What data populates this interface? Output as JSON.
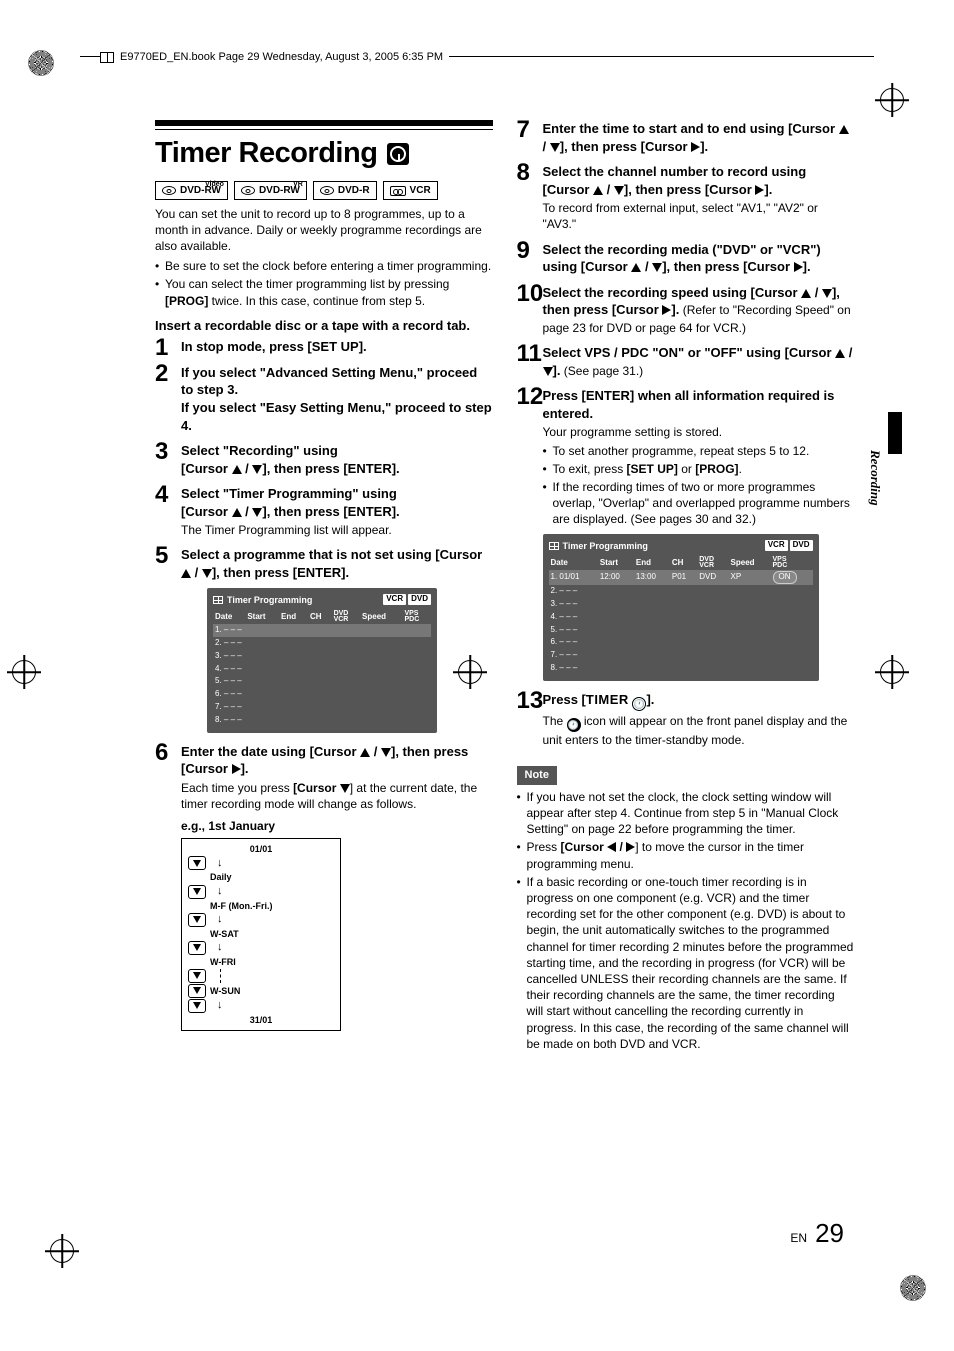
{
  "meta": {
    "header_text": "E9770ED_EN.book  Page 29  Wednesday, August 3, 2005  6:35 PM",
    "side_tab": "Recording",
    "footer_lang": "EN",
    "footer_page": "29"
  },
  "title": "Timer Recording",
  "formats": {
    "f1_label": "DVD-RW",
    "f1_sup": "Video",
    "f2_label": "DVD-RW",
    "f2_sup": "VR",
    "f3_label": "DVD-R",
    "f4_label": "VCR"
  },
  "intro": {
    "p1": "You can set the unit to record up to 8 programmes, up to a month in advance. Daily or weekly programme recordings are also available.",
    "b1": "Be sure to set the clock before entering a timer programming.",
    "b2_a": "You can select the timer programming list by pressing ",
    "b2_prog": "[PROG]",
    "b2_b": " twice. In this case, continue from step 5."
  },
  "lead": "Insert a recordable disc or a tape with a record tab.",
  "steps_left": {
    "s1": "In stop mode, press [SET UP].",
    "s2a": "If you select \"Advanced Setting Menu,\" proceed to step 3.",
    "s2b": "If you select \"Easy Setting Menu,\" proceed to step 4.",
    "s3a": "Select \"Recording\" using",
    "s3b": "[Cursor ",
    "s3c": "], then press [ENTER].",
    "s4a": "Select \"Timer Programming\" using",
    "s4b": "[Cursor ",
    "s4c": "], then press [ENTER].",
    "s4_body": "The Timer Programming list will appear.",
    "s5a": "Select a programme that is not set using [Cursor ",
    "s5b": "], then press [ENTER].",
    "s6a": "Enter the date using [Cursor ",
    "s6b": "], then press [Cursor ",
    "s6c": "].",
    "s6_body_a": "Each time you press ",
    "s6_body_cur": "[Cursor ",
    "s6_body_b": "] at the current date, the timer recording mode will change as follows.",
    "eg": "e.g., 1st January"
  },
  "osd1": {
    "title": "Timer Programming",
    "vcr": "VCR",
    "dvd": "DVD",
    "h_date": "Date",
    "h_start": "Start",
    "h_end": "End",
    "h_ch": "CH",
    "h_dvdvcr_top": "DVD",
    "h_dvdvcr_bot": "VCR",
    "h_speed": "Speed",
    "h_vps_top": "VPS",
    "h_vps_bot": "PDC",
    "rows": [
      "1. – – –",
      "2. – – –",
      "3. – – –",
      "4. – – –",
      "5. – – –",
      "6. – – –",
      "7. – – –",
      "8. – – –"
    ]
  },
  "flow": {
    "top": "01/01",
    "items": [
      "Daily",
      "M-F (Mon.-Fri.)",
      "W-SAT",
      "W-FRI",
      "",
      "W-SUN"
    ],
    "bottom": "31/01"
  },
  "steps_right": {
    "s7a": "Enter the time to start and to end using [Cursor ",
    "s7b": "], then press [Cursor ",
    "s7c": "].",
    "s8a": "Select the channel number to record using [Cursor ",
    "s8b": "], then press [Cursor ",
    "s8c": "].",
    "s8_body": "To record from external input, select \"AV1,\" \"AV2\" or \"AV3.\"",
    "s9a": "Select the recording media (\"DVD\" or \"VCR\") using [Cursor ",
    "s9b": "], then press [Cursor ",
    "s9c": "].",
    "s10a": "Select the recording speed using [Cursor ",
    "s10b": "], then press [Cursor ",
    "s10c": "].",
    "s10_body": " (Refer to \"Recording Speed\" on page 23 for DVD or page 64 for VCR.)",
    "s11a": "Select VPS / PDC \"ON\" or \"OFF\" using [Cursor ",
    "s11b": "].",
    "s11_body": " (See page 31.)",
    "s12a": "Press [ENTER] when all information required is entered.",
    "s12_body1": "Your programme setting is stored.",
    "s12_b1": "To set another programme, repeat steps 5 to 12.",
    "s12_b2a": "To exit, press ",
    "s12_b2_setup": "[SET UP]",
    "s12_b2_or": " or ",
    "s12_b2_prog": "[PROG]",
    "s12_b2b": ".",
    "s12_b3": "If the recording times of two or more programmes overlap, \"Overlap\" and overlapped programme numbers are displayed. (See pages 30 and 32.)",
    "s13a": "Press [",
    "s13_timer": "TIMER",
    "s13b": "].",
    "s13_body_a": "The ",
    "s13_body_b": " icon will appear on the front panel display and the unit enters to the timer-standby mode."
  },
  "osd2": {
    "title": "Timer Programming",
    "vcr": "VCR",
    "dvd": "DVD",
    "h_date": "Date",
    "h_start": "Start",
    "h_end": "End",
    "h_ch": "CH",
    "h_dvdvcr_top": "DVD",
    "h_dvdvcr_bot": "VCR",
    "h_speed": "Speed",
    "h_vps_top": "VPS",
    "h_vps_bot": "PDC",
    "row1": {
      "date": "01/01",
      "start": "12:00",
      "end": "13:00",
      "ch": "P01",
      "dv": "DVD",
      "speed": "XP",
      "vps": "ON"
    },
    "rows": [
      "2. – – –",
      "3. – – –",
      "4. – – –",
      "5. – – –",
      "6. – – –",
      "7. – – –",
      "8. – – –"
    ]
  },
  "note": {
    "label": "Note",
    "n1": "If you have not set the clock, the clock setting window will appear after step 4.  Continue from step 5 in \"Manual Clock Setting\" on page 22 before programming the timer.",
    "n2a": "Press ",
    "n2_cur": "[Cursor ",
    "n2b": "] to move the cursor in the timer programming menu.",
    "n3": "If a basic recording or one-touch timer recording is in progress on one component (e.g. VCR) and the timer recording set for the other component (e.g. DVD) is about to begin, the unit automatically switches to the programmed channel for timer recording 2 minutes before the programmed starting time, and the recording in progress (for VCR) will be cancelled UNLESS their recording channels are the same.  If their recording channels are the same, the timer recording will start without cancelling the recording currently in progress.  In this case, the recording of the same channel will be made on both DVD and VCR."
  }
}
